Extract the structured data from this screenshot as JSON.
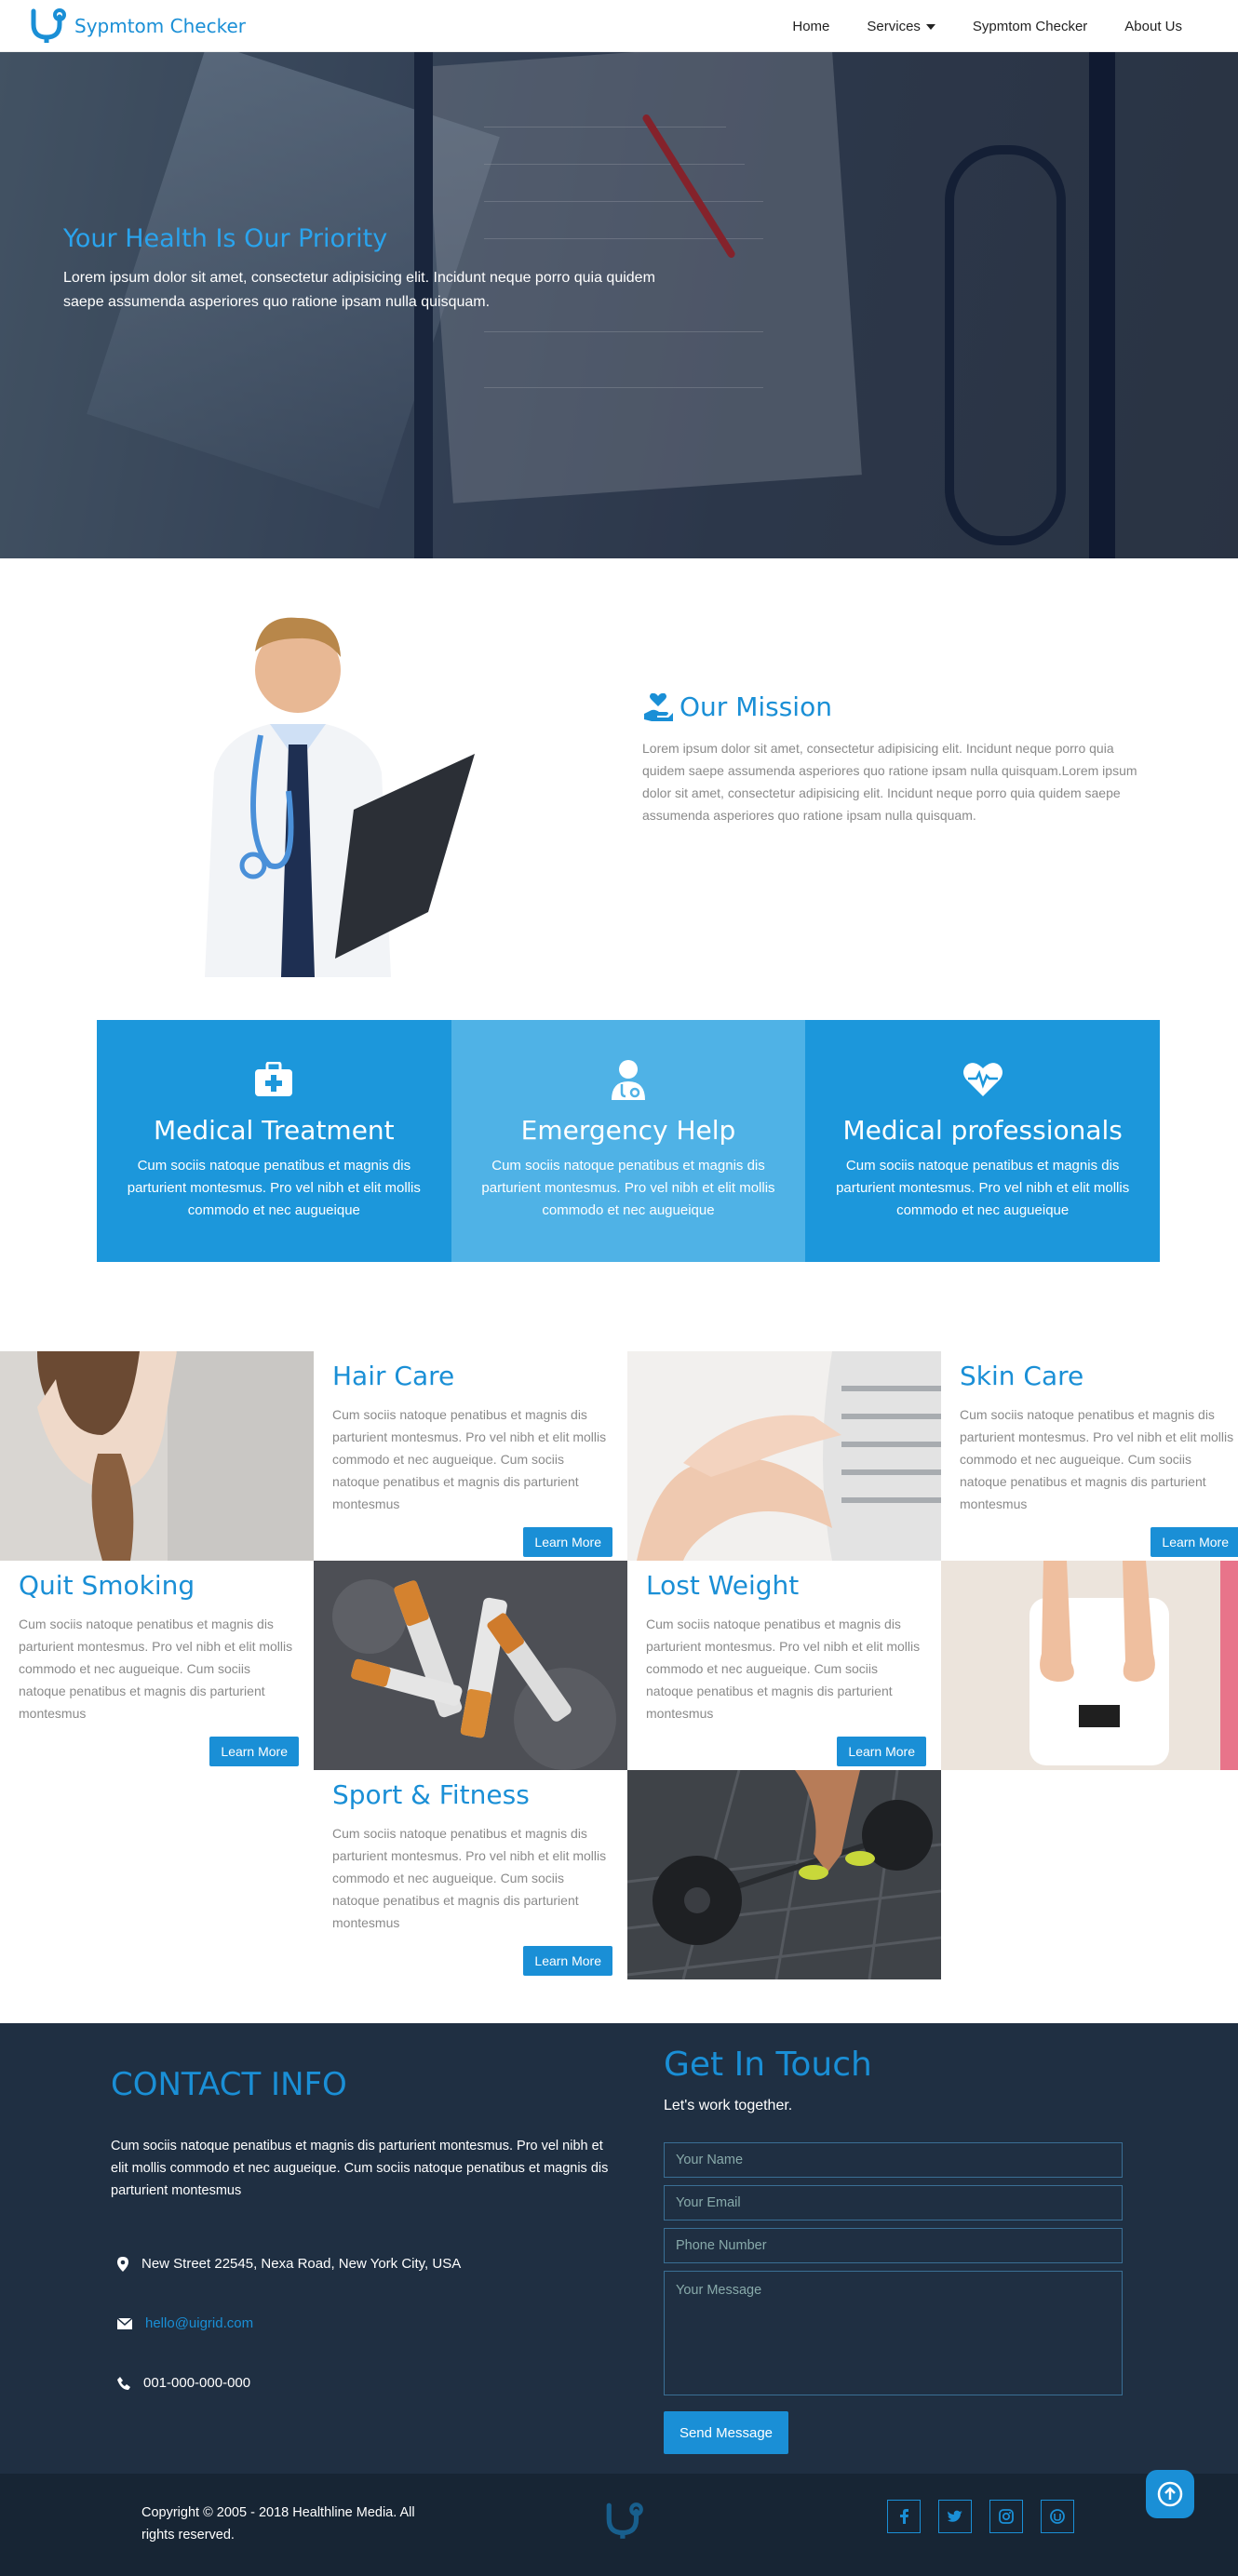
{
  "brand": {
    "name": "Sypmtom Checker"
  },
  "nav": {
    "home": "Home",
    "services": "Services",
    "checker": "Sypmtom Checker",
    "about": "About Us"
  },
  "hero": {
    "title": "Your Health Is Our Priority",
    "text": "Lorem ipsum dolor sit amet, consectetur adipisicing elit. Incidunt neque porro quia quidem saepe assumenda asperiores quo ratione ipsam nulla quisquam."
  },
  "mission": {
    "title": "Our Mission",
    "text": "Lorem ipsum dolor sit amet, consectetur adipisicing elit. Incidunt neque porro quia quidem saepe assumenda asperiores quo ratione ipsam nulla quisquam.Lorem ipsum dolor sit amet, consectetur adipisicing elit. Incidunt neque porro quia quidem saepe assumenda asperiores quo ratione ipsam nulla quisquam."
  },
  "features": [
    {
      "title": "Medical Treatment",
      "text": "Cum sociis natoque penatibus et magnis dis parturient montesmus. Pro vel nibh et elit mollis commodo et nec augueique",
      "icon": "first-aid-kit-icon"
    },
    {
      "title": "Emergency Help",
      "text": "Cum sociis natoque penatibus et magnis dis parturient montesmus. Pro vel nibh et elit mollis commodo et nec augueique",
      "icon": "doctor-icon"
    },
    {
      "title": "Medical professionals",
      "text": "Cum sociis natoque penatibus et magnis dis parturient montesmus. Pro vel nibh et elit mollis commodo et nec augueique",
      "icon": "heartbeat-icon"
    }
  ],
  "services": {
    "button_label": "Learn More",
    "text": "Cum sociis natoque penatibus et magnis dis parturient montesmus. Pro vel nibh et elit mollis commodo et nec augueique. Cum sociis natoque penatibus et magnis dis parturient montesmus",
    "hair_care": "Hair Care",
    "skin_care": "Skin Care",
    "quit_smoking": "Quit Smoking",
    "lost_weight": "Lost Weight",
    "sport_fitness": "Sport & Fitness"
  },
  "contact": {
    "title": "CONTACT INFO",
    "text": "Cum sociis natoque penatibus et magnis dis parturient montesmus. Pro vel nibh et elit mollis commodo et nec augueique. Cum sociis natoque penatibus et magnis dis parturient montesmus",
    "address": "New Street 22545, Nexa Road, New York City, USA",
    "email": "hello@uigrid.com",
    "phone": "001-000-000-000"
  },
  "touch": {
    "title": "Get In Touch",
    "subtitle": "Let's work together.",
    "name_placeholder": "Your Name",
    "email_placeholder": "Your Email",
    "phone_placeholder": "Phone Number",
    "message_placeholder": "Your Message",
    "send_label": "Send Message"
  },
  "footer": {
    "copyright": "Copyright © 2005 - 2018 Healthline Media. All rights reserved."
  },
  "colors": {
    "accent": "#1a8fd6",
    "dark": "#1f2f42",
    "footer": "#172534"
  }
}
